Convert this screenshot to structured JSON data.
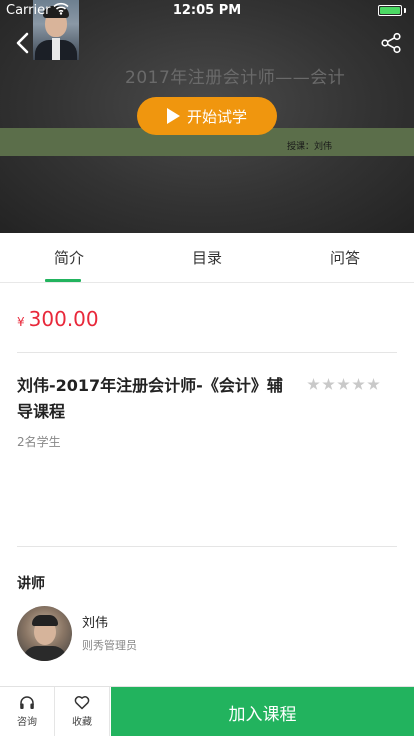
{
  "status_bar": {
    "carrier": "Carrier",
    "time": "12:05 PM"
  },
  "video": {
    "course_banner_title": "2017年注册会计师——会计",
    "play_label": "开始试学",
    "teacher_line": "授课：刘伟"
  },
  "tabs": [
    {
      "label": "简介",
      "active": true
    },
    {
      "label": "目录",
      "active": false
    },
    {
      "label": "问答",
      "active": false
    }
  ],
  "course": {
    "currency_symbol": "¥",
    "price": "300.00",
    "title": "刘伟-2017年注册会计师-《会计》辅导课程",
    "rating_stars": 5,
    "students": "2名学生"
  },
  "lecturer": {
    "section_label": "讲师",
    "name": "刘伟",
    "role": "则秀管理员"
  },
  "bottom_bar": {
    "consult_label": "咨询",
    "favorite_label": "收藏",
    "join_label": "加入课程"
  },
  "colors": {
    "accent_green": "#22b35e",
    "play_orange": "#f0960e",
    "price_red": "#e8283a"
  },
  "icons": [
    "wifi-icon",
    "battery-icon",
    "back-icon",
    "share-icon",
    "play-icon",
    "star-icon",
    "headphones-icon",
    "heart-icon"
  ]
}
